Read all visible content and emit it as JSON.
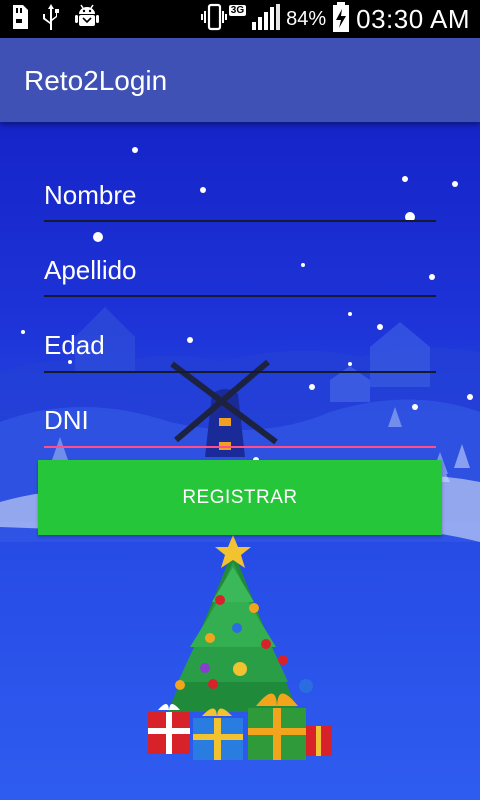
{
  "status_bar": {
    "battery_percent": "84%",
    "time": "03:30 AM",
    "network_type": "3G",
    "icons": [
      "sd-card-icon",
      "usb-icon",
      "android-debug-icon",
      "vibrate-icon",
      "signal-icon",
      "battery-charging-icon"
    ]
  },
  "app_bar": {
    "title": "Reto2Login"
  },
  "form": {
    "fields": [
      {
        "label": "Nombre"
      },
      {
        "label": "Apellido"
      },
      {
        "label": "Edad"
      },
      {
        "label": "DNI"
      }
    ],
    "register_label": "REGISTRAR"
  },
  "colors": {
    "app_bar": "#3f51b5",
    "button": "#26c63a",
    "focused_underline": "#ff4f8b"
  }
}
